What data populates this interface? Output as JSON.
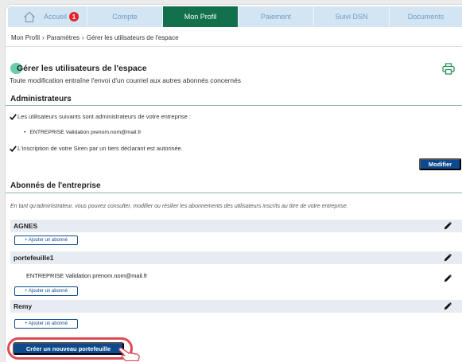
{
  "colors": {
    "tab_bg": "#d3e5f2",
    "tab_text": "#6e9bc5",
    "active_tab_bg": "#13704c",
    "badge_bg": "#e2242c",
    "accent_blue": "#0d4a8d",
    "highlight": "#dc4a55",
    "brand_green": "#6ccdab",
    "row_bg": "#e7ecf3"
  },
  "nav": {
    "tabs": [
      {
        "label": "Accueil",
        "icon": "home-icon",
        "badge": "1",
        "active": false
      },
      {
        "label": "Compte",
        "active": false
      },
      {
        "label": "Mon Profil",
        "active": true
      },
      {
        "label": "Paiement",
        "active": false
      },
      {
        "label": "Suivi DSN",
        "active": false
      },
      {
        "label": "Documents",
        "active": false
      }
    ]
  },
  "breadcrumb": {
    "separator": "›",
    "items": [
      "Mon Profil",
      "Paramètres",
      "Gérer les utilisateurs de l'espace"
    ]
  },
  "page": {
    "title": "Gérer les utilisateurs de l'espace",
    "subtitle": "Toute modification entraîne l'envoi d'un courriel aux autres abonnés concernés",
    "print_icon": "printer-icon"
  },
  "administrators": {
    "heading": "Administrateurs",
    "check_icon": "check-icon",
    "intro": "Les utilisateurs suivants sont administrateurs de votre entreprise :",
    "users": [
      "ENTREPRISE Validation prenom.nom@mail.fr"
    ],
    "siren_note": "L'inscription de votre Siren par un tiers déclarant est autorisée.",
    "modify_button": "Modifier"
  },
  "subscribers": {
    "heading": "Abonnés de l'entreprise",
    "note": "En tant qu'administrateur, vous pouvez consulter, modifier ou résilier les abonnements des utilisateurs inscrits au titre de votre entreprise.",
    "edit_icon": "pencil-icon",
    "groups": [
      {
        "name": "AGNES",
        "members": [],
        "add_button": "+ Ajouter un abonné"
      },
      {
        "name": "portefeuille1",
        "members": [
          "ENTREPRISE Validation prenom.nom@mail.fr"
        ],
        "add_button": "+ Ajouter un abonné"
      },
      {
        "name": "Remy",
        "members": [],
        "add_button": "+ Ajouter un abonné"
      }
    ],
    "create_button": "Créer un nouveau portefeuille"
  },
  "cursor_icon": "hand-pointer-icon"
}
